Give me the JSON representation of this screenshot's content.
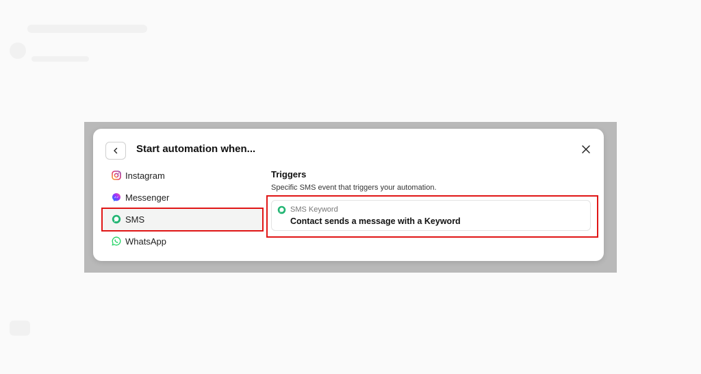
{
  "modal": {
    "title": "Start automation when..."
  },
  "sidebar": {
    "items": [
      {
        "label": "Instagram",
        "icon": "instagram-icon"
      },
      {
        "label": "Messenger",
        "icon": "messenger-icon"
      },
      {
        "label": "SMS",
        "icon": "sms-icon",
        "active": true
      },
      {
        "label": "WhatsApp",
        "icon": "whatsapp-icon"
      }
    ]
  },
  "triggers": {
    "heading": "Triggers",
    "description": "Specific SMS event that triggers your automation.",
    "cards": [
      {
        "label": "SMS Keyword",
        "title": "Contact sends a message with a Keyword",
        "icon": "sms-icon"
      }
    ]
  },
  "colors": {
    "highlight": "#e01515",
    "sms_green": "#22b573",
    "whatsapp_green": "#25d366",
    "overlay": "#b9b9b9"
  }
}
